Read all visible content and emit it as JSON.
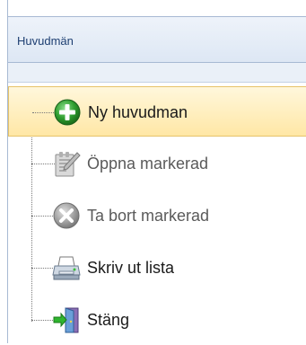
{
  "panel": {
    "title": "Huvudmän"
  },
  "tree": {
    "items": [
      {
        "label": "Ny huvudman",
        "icon": "add-icon",
        "state": "selected"
      },
      {
        "label": "Öppna markerad",
        "icon": "edit-icon",
        "state": "disabled"
      },
      {
        "label": "Ta bort markerad",
        "icon": "delete-icon",
        "state": "disabled"
      },
      {
        "label": "Skriv ut lista",
        "icon": "printer-icon",
        "state": "enabled"
      },
      {
        "label": "Stäng",
        "icon": "exit-door-icon",
        "state": "enabled"
      }
    ]
  },
  "colors": {
    "header_text": "#1e3f72",
    "selection_fill": "#ffe7a6",
    "selection_border": "#e6c36a",
    "add_green": "#2f9e2f",
    "delete_gray": "#9a9a9a"
  }
}
